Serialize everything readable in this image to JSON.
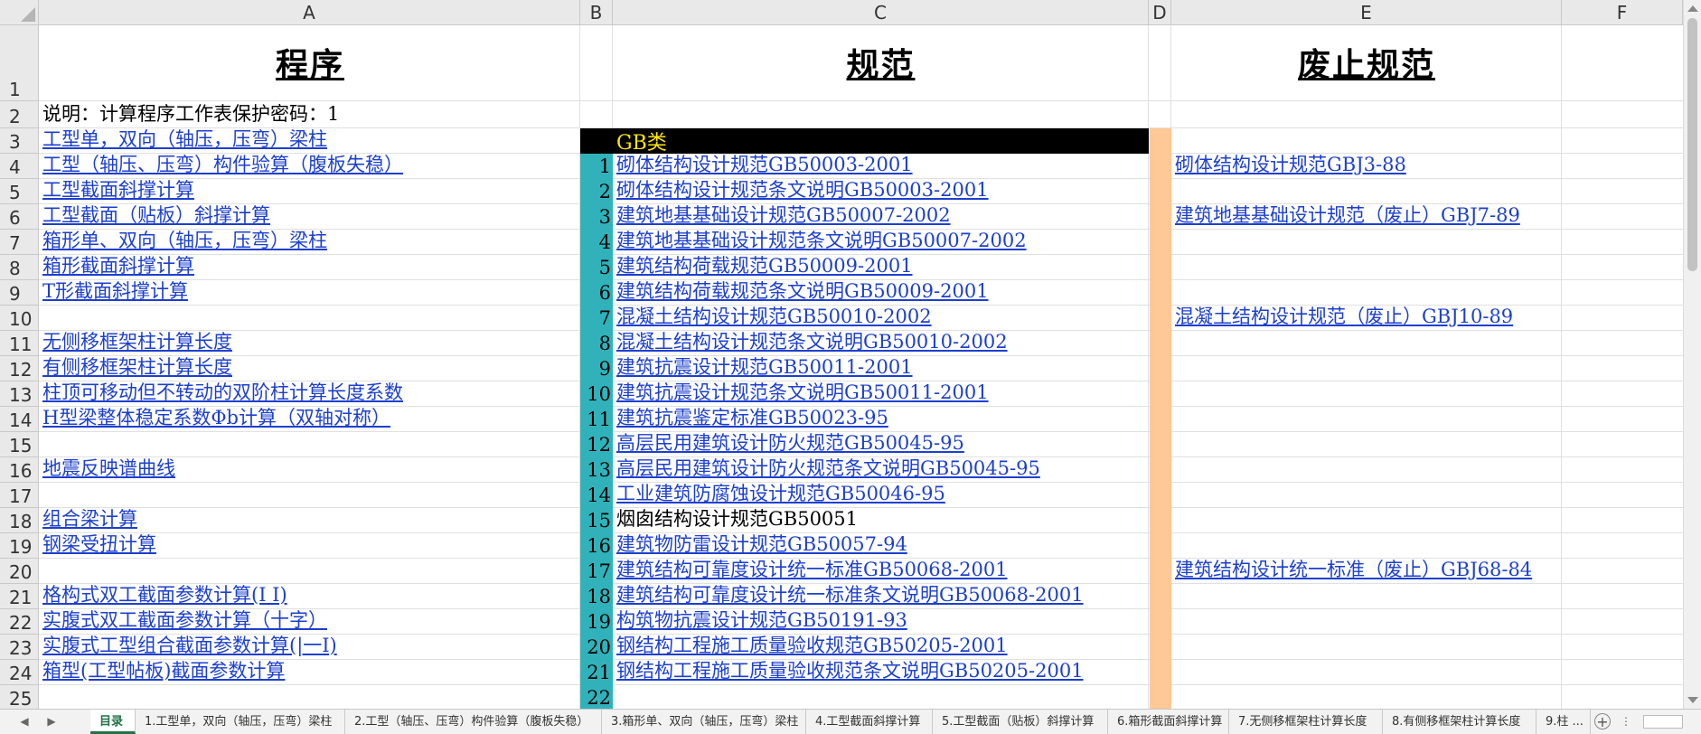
{
  "columns": [
    "A",
    "B",
    "C",
    "D",
    "E",
    "F"
  ],
  "row_numbers": [
    "1",
    "2",
    "3",
    "4",
    "5",
    "6",
    "7",
    "8",
    "9",
    "10",
    "11",
    "12",
    "13",
    "14",
    "15",
    "16",
    "17",
    "18",
    "19",
    "20",
    "21",
    "22",
    "23",
    "24",
    "25"
  ],
  "headers": {
    "program": "程序",
    "spec": "规范",
    "abolished": "废止规范"
  },
  "note": "说明：计算程序工作表保护密码：1",
  "gb_label": "GB类",
  "programs": [
    "工型单，双向（轴压，压弯）梁柱",
    "工型（轴压、压弯）构件验算（腹板失稳）",
    "工型截面斜撑计算",
    "工型截面（贴板）斜撑计算",
    "箱形单、双向（轴压，压弯）梁柱",
    "箱形截面斜撑计算",
    "T形截面斜撑计算",
    "",
    "无侧移框架柱计算长度",
    "有侧移框架柱计算长度",
    "柱顶可移动但不转动的双阶柱计算长度系数",
    "H型梁整体稳定系数Φb计算（双轴对称）",
    "",
    "地震反映谱曲线",
    "",
    "组合梁计算",
    "钢梁受扭计算",
    "",
    "格构式双工截面参数计算(I  I)",
    "实腹式双工截面参数计算（十字）",
    "实腹式工型组合截面参数计算(|一I)",
    "箱型(工型帖板)截面参数计算"
  ],
  "specs": [
    {
      "n": "1",
      "t": "砌体结构设计规范GB50003-2001",
      "link": true
    },
    {
      "n": "2",
      "t": "砌体结构设计规范条文说明GB50003-2001",
      "link": true
    },
    {
      "n": "3",
      "t": "建筑地基基础设计规范GB50007-2002",
      "link": true
    },
    {
      "n": "4",
      "t": "建筑地基基础设计规范条文说明GB50007-2002",
      "link": true
    },
    {
      "n": "5",
      "t": "建筑结构荷载规范GB50009-2001",
      "link": true
    },
    {
      "n": "6",
      "t": "建筑结构荷载规范条文说明GB50009-2001",
      "link": true
    },
    {
      "n": "7",
      "t": "混凝土结构设计规范GB50010-2002",
      "link": true
    },
    {
      "n": "8",
      "t": "混凝土结构设计规范条文说明GB50010-2002",
      "link": true
    },
    {
      "n": "9",
      "t": "建筑抗震设计规范GB50011-2001",
      "link": true
    },
    {
      "n": "10",
      "t": "建筑抗震设计规范条文说明GB50011-2001",
      "link": true
    },
    {
      "n": "11",
      "t": "建筑抗震鉴定标准GB50023-95",
      "link": true
    },
    {
      "n": "12",
      "t": "高层民用建筑设计防火规范GB50045-95",
      "link": true
    },
    {
      "n": "13",
      "t": "高层民用建筑设计防火规范条文说明GB50045-95",
      "link": true
    },
    {
      "n": "14",
      "t": "工业建筑防腐蚀设计规范GB50046-95",
      "link": true
    },
    {
      "n": "15",
      "t": "烟囱结构设计规范GB50051",
      "link": false
    },
    {
      "n": "16",
      "t": "建筑物防雷设计规范GB50057-94",
      "link": true
    },
    {
      "n": "17",
      "t": "建筑结构可靠度设计统一标准GB50068-2001",
      "link": true
    },
    {
      "n": "18",
      "t": "建筑结构可靠度设计统一标准条文说明GB50068-2001",
      "link": true
    },
    {
      "n": "19",
      "t": "构筑物抗震设计规范GB50191-93",
      "link": true
    },
    {
      "n": "20",
      "t": "钢结构工程施工质量验收规范GB50205-2001",
      "link": true
    },
    {
      "n": "21",
      "t": "钢结构工程施工质量验收规范条文说明GB50205-2001",
      "link": true
    },
    {
      "n": "22",
      "t": "",
      "link": false
    }
  ],
  "abolished": [
    "砌体结构设计规范GBJ3-88",
    "",
    "建筑地基基础设计规范（废止）GBJ7-89",
    "",
    "",
    "",
    "混凝土结构设计规范（废止）GBJ10-89",
    "",
    "",
    "",
    "",
    "",
    "",
    "",
    "",
    "",
    "建筑结构设计统一标准（废止）GBJ68-84",
    "",
    "",
    "",
    "",
    ""
  ],
  "tabs": [
    "目录",
    "1.工型单，双向（轴压，压弯）梁柱",
    "2.工型（轴压、压弯）构件验算（腹板失稳）",
    "3.箱形单、双向（轴压，压弯）梁柱",
    "4.工型截面斜撑计算",
    "5.工型截面（贴板）斜撑计算",
    "6.箱形截面斜撑计算",
    "7.无侧移框架柱计算长度",
    "8.有侧移框架柱计算长度",
    "9.柱 ..."
  ],
  "colors": {
    "accent": "#31b2ba",
    "peach": "#ffc896",
    "link": "#1c3fcf",
    "gb_text": "#ffe600",
    "active_tab": "#217346"
  }
}
